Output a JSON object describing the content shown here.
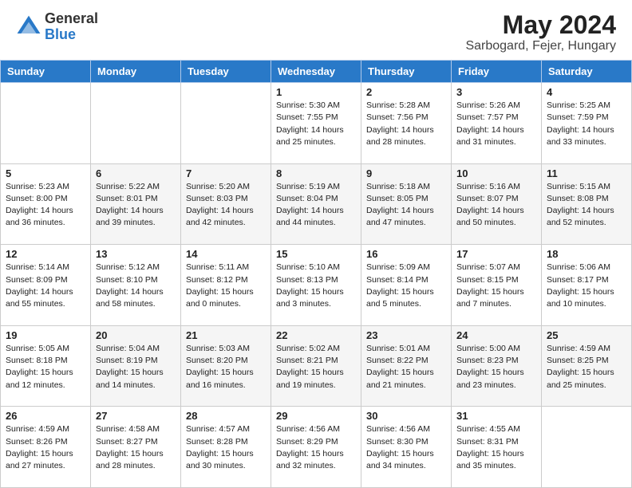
{
  "header": {
    "logo_general": "General",
    "logo_blue": "Blue",
    "month_year": "May 2024",
    "location": "Sarbogard, Fejer, Hungary"
  },
  "days_of_week": [
    "Sunday",
    "Monday",
    "Tuesday",
    "Wednesday",
    "Thursday",
    "Friday",
    "Saturday"
  ],
  "weeks": [
    [
      {
        "day": "",
        "sunrise": "",
        "sunset": "",
        "daylight": ""
      },
      {
        "day": "",
        "sunrise": "",
        "sunset": "",
        "daylight": ""
      },
      {
        "day": "",
        "sunrise": "",
        "sunset": "",
        "daylight": ""
      },
      {
        "day": "1",
        "sunrise": "Sunrise: 5:30 AM",
        "sunset": "Sunset: 7:55 PM",
        "daylight": "Daylight: 14 hours and 25 minutes."
      },
      {
        "day": "2",
        "sunrise": "Sunrise: 5:28 AM",
        "sunset": "Sunset: 7:56 PM",
        "daylight": "Daylight: 14 hours and 28 minutes."
      },
      {
        "day": "3",
        "sunrise": "Sunrise: 5:26 AM",
        "sunset": "Sunset: 7:57 PM",
        "daylight": "Daylight: 14 hours and 31 minutes."
      },
      {
        "day": "4",
        "sunrise": "Sunrise: 5:25 AM",
        "sunset": "Sunset: 7:59 PM",
        "daylight": "Daylight: 14 hours and 33 minutes."
      }
    ],
    [
      {
        "day": "5",
        "sunrise": "Sunrise: 5:23 AM",
        "sunset": "Sunset: 8:00 PM",
        "daylight": "Daylight: 14 hours and 36 minutes."
      },
      {
        "day": "6",
        "sunrise": "Sunrise: 5:22 AM",
        "sunset": "Sunset: 8:01 PM",
        "daylight": "Daylight: 14 hours and 39 minutes."
      },
      {
        "day": "7",
        "sunrise": "Sunrise: 5:20 AM",
        "sunset": "Sunset: 8:03 PM",
        "daylight": "Daylight: 14 hours and 42 minutes."
      },
      {
        "day": "8",
        "sunrise": "Sunrise: 5:19 AM",
        "sunset": "Sunset: 8:04 PM",
        "daylight": "Daylight: 14 hours and 44 minutes."
      },
      {
        "day": "9",
        "sunrise": "Sunrise: 5:18 AM",
        "sunset": "Sunset: 8:05 PM",
        "daylight": "Daylight: 14 hours and 47 minutes."
      },
      {
        "day": "10",
        "sunrise": "Sunrise: 5:16 AM",
        "sunset": "Sunset: 8:07 PM",
        "daylight": "Daylight: 14 hours and 50 minutes."
      },
      {
        "day": "11",
        "sunrise": "Sunrise: 5:15 AM",
        "sunset": "Sunset: 8:08 PM",
        "daylight": "Daylight: 14 hours and 52 minutes."
      }
    ],
    [
      {
        "day": "12",
        "sunrise": "Sunrise: 5:14 AM",
        "sunset": "Sunset: 8:09 PM",
        "daylight": "Daylight: 14 hours and 55 minutes."
      },
      {
        "day": "13",
        "sunrise": "Sunrise: 5:12 AM",
        "sunset": "Sunset: 8:10 PM",
        "daylight": "Daylight: 14 hours and 58 minutes."
      },
      {
        "day": "14",
        "sunrise": "Sunrise: 5:11 AM",
        "sunset": "Sunset: 8:12 PM",
        "daylight": "Daylight: 15 hours and 0 minutes."
      },
      {
        "day": "15",
        "sunrise": "Sunrise: 5:10 AM",
        "sunset": "Sunset: 8:13 PM",
        "daylight": "Daylight: 15 hours and 3 minutes."
      },
      {
        "day": "16",
        "sunrise": "Sunrise: 5:09 AM",
        "sunset": "Sunset: 8:14 PM",
        "daylight": "Daylight: 15 hours and 5 minutes."
      },
      {
        "day": "17",
        "sunrise": "Sunrise: 5:07 AM",
        "sunset": "Sunset: 8:15 PM",
        "daylight": "Daylight: 15 hours and 7 minutes."
      },
      {
        "day": "18",
        "sunrise": "Sunrise: 5:06 AM",
        "sunset": "Sunset: 8:17 PM",
        "daylight": "Daylight: 15 hours and 10 minutes."
      }
    ],
    [
      {
        "day": "19",
        "sunrise": "Sunrise: 5:05 AM",
        "sunset": "Sunset: 8:18 PM",
        "daylight": "Daylight: 15 hours and 12 minutes."
      },
      {
        "day": "20",
        "sunrise": "Sunrise: 5:04 AM",
        "sunset": "Sunset: 8:19 PM",
        "daylight": "Daylight: 15 hours and 14 minutes."
      },
      {
        "day": "21",
        "sunrise": "Sunrise: 5:03 AM",
        "sunset": "Sunset: 8:20 PM",
        "daylight": "Daylight: 15 hours and 16 minutes."
      },
      {
        "day": "22",
        "sunrise": "Sunrise: 5:02 AM",
        "sunset": "Sunset: 8:21 PM",
        "daylight": "Daylight: 15 hours and 19 minutes."
      },
      {
        "day": "23",
        "sunrise": "Sunrise: 5:01 AM",
        "sunset": "Sunset: 8:22 PM",
        "daylight": "Daylight: 15 hours and 21 minutes."
      },
      {
        "day": "24",
        "sunrise": "Sunrise: 5:00 AM",
        "sunset": "Sunset: 8:23 PM",
        "daylight": "Daylight: 15 hours and 23 minutes."
      },
      {
        "day": "25",
        "sunrise": "Sunrise: 4:59 AM",
        "sunset": "Sunset: 8:25 PM",
        "daylight": "Daylight: 15 hours and 25 minutes."
      }
    ],
    [
      {
        "day": "26",
        "sunrise": "Sunrise: 4:59 AM",
        "sunset": "Sunset: 8:26 PM",
        "daylight": "Daylight: 15 hours and 27 minutes."
      },
      {
        "day": "27",
        "sunrise": "Sunrise: 4:58 AM",
        "sunset": "Sunset: 8:27 PM",
        "daylight": "Daylight: 15 hours and 28 minutes."
      },
      {
        "day": "28",
        "sunrise": "Sunrise: 4:57 AM",
        "sunset": "Sunset: 8:28 PM",
        "daylight": "Daylight: 15 hours and 30 minutes."
      },
      {
        "day": "29",
        "sunrise": "Sunrise: 4:56 AM",
        "sunset": "Sunset: 8:29 PM",
        "daylight": "Daylight: 15 hours and 32 minutes."
      },
      {
        "day": "30",
        "sunrise": "Sunrise: 4:56 AM",
        "sunset": "Sunset: 8:30 PM",
        "daylight": "Daylight: 15 hours and 34 minutes."
      },
      {
        "day": "31",
        "sunrise": "Sunrise: 4:55 AM",
        "sunset": "Sunset: 8:31 PM",
        "daylight": "Daylight: 15 hours and 35 minutes."
      },
      {
        "day": "",
        "sunrise": "",
        "sunset": "",
        "daylight": ""
      }
    ]
  ]
}
